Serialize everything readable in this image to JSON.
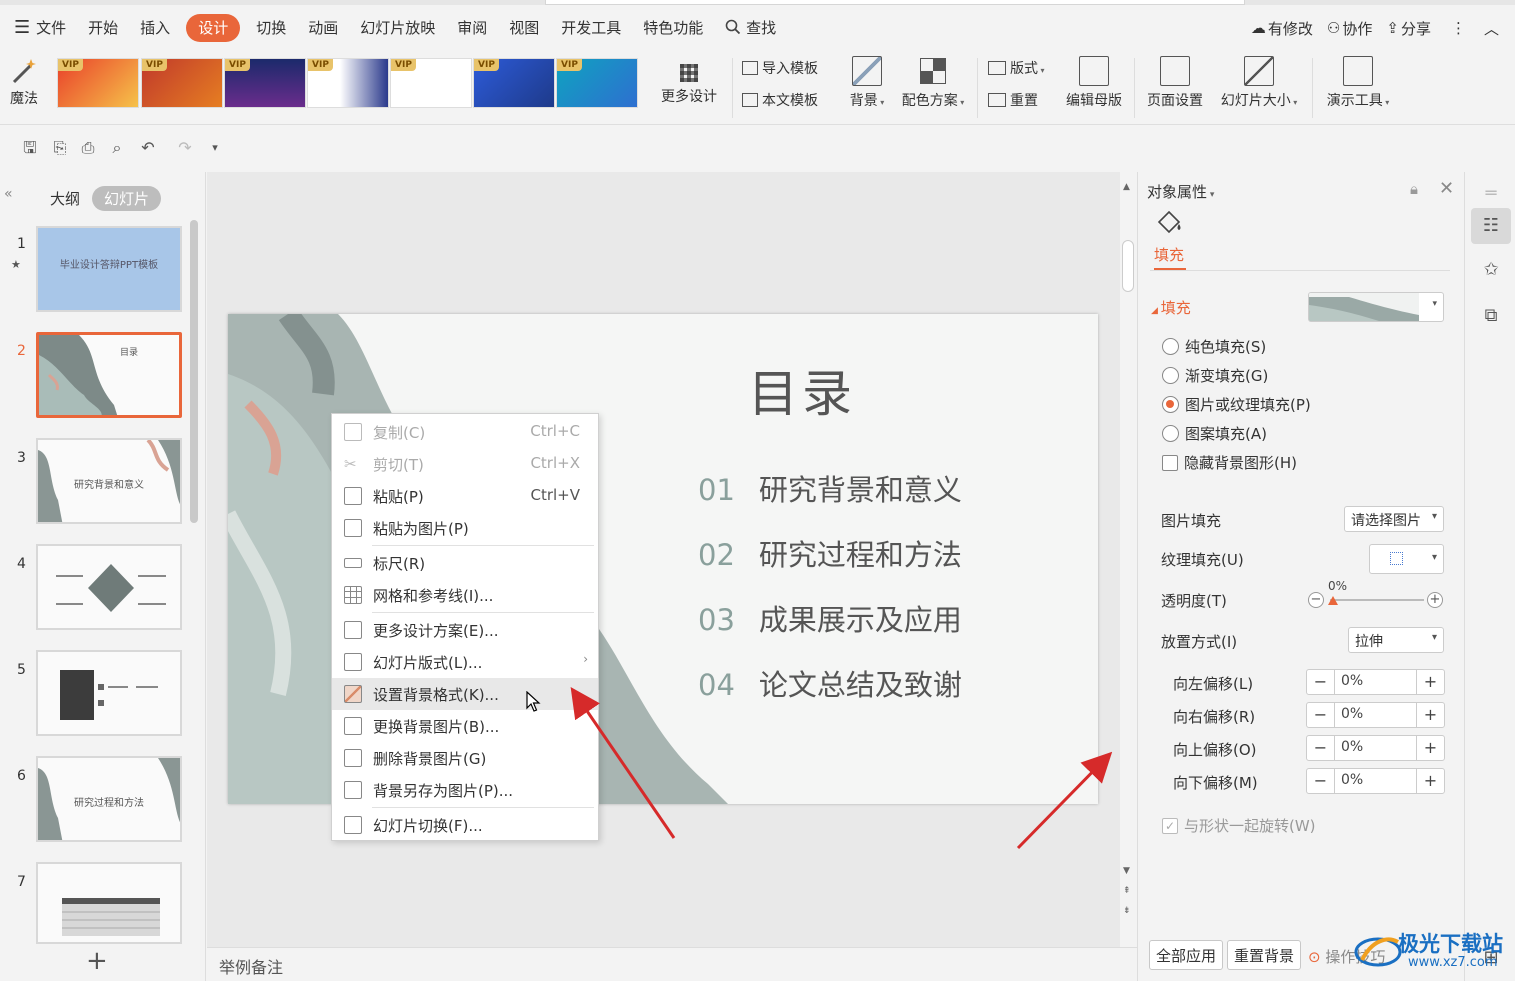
{
  "menu": {
    "items": [
      "文件",
      "开始",
      "插入",
      "设计",
      "切换",
      "动画",
      "幻灯片放映",
      "审阅",
      "视图",
      "开发工具",
      "特色功能"
    ],
    "active": "设计",
    "search_label": "查找",
    "right": {
      "modified": "有修改",
      "collab": "协作",
      "share": "分享"
    }
  },
  "ribbon": {
    "magic": "魔法",
    "vip_badge": "VIP",
    "template_titles": [
      "",
      "",
      "",
      "",
      "",
      "",
      ""
    ],
    "more_design": "更多设计",
    "import_template": "导入模板",
    "this_template": "本文模板",
    "background": "背景",
    "color_scheme": "配色方案",
    "layout": "版式",
    "reset": "重置",
    "edit_master": "编辑母版",
    "page_setup": "页面设置",
    "slide_size": "幻灯片大小",
    "presenter_tools": "演示工具"
  },
  "left_panel": {
    "tab_outline": "大纲",
    "tab_slides": "幻灯片",
    "slides": [
      {
        "num": "1",
        "text": "毕业设计答辩PPT模板"
      },
      {
        "num": "2",
        "text": "目录"
      },
      {
        "num": "3",
        "text": "研究背景和意义"
      },
      {
        "num": "4",
        "text": ""
      },
      {
        "num": "5",
        "text": ""
      },
      {
        "num": "6",
        "text": "研究过程和方法"
      },
      {
        "num": "7",
        "text": ""
      }
    ],
    "selected": "2",
    "add_symbol": "+"
  },
  "slide": {
    "title": "目录",
    "rows": [
      {
        "n": "01",
        "text": "研究背景和意义"
      },
      {
        "n": "02",
        "text": "研究过程和方法"
      },
      {
        "n": "03",
        "text": "成果展示及应用"
      },
      {
        "n": "04",
        "text": "论文总结及致谢"
      }
    ]
  },
  "notes_placeholder": "举例备注",
  "context_menu": {
    "items": [
      {
        "label": "复制(C)",
        "shortcut": "Ctrl+C",
        "disabled": true
      },
      {
        "label": "剪切(T)",
        "shortcut": "Ctrl+X",
        "disabled": true
      },
      {
        "label": "粘贴(P)",
        "shortcut": "Ctrl+V",
        "disabled": false
      },
      {
        "label": "粘贴为图片(P)",
        "shortcut": "",
        "disabled": false
      },
      {
        "label": "标尺(R)",
        "shortcut": "",
        "disabled": false
      },
      {
        "label": "网格和参考线(I)...",
        "shortcut": "",
        "disabled": false
      },
      {
        "label": "更多设计方案(E)...",
        "shortcut": "",
        "disabled": false
      },
      {
        "label": "幻灯片版式(L)...",
        "shortcut": "",
        "disabled": false
      },
      {
        "label": "设置背景格式(K)...",
        "shortcut": "",
        "disabled": false,
        "highlighted": true
      },
      {
        "label": "更换背景图片(B)...",
        "shortcut": "",
        "disabled": false
      },
      {
        "label": "删除背景图片(G)",
        "shortcut": "",
        "disabled": false
      },
      {
        "label": "背景另存为图片(P)...",
        "shortcut": "",
        "disabled": false
      },
      {
        "label": "幻灯片切换(F)...",
        "shortcut": "",
        "disabled": false
      }
    ]
  },
  "props": {
    "title": "对象属性",
    "tab": "填充",
    "section": "填充",
    "fill_options": [
      "纯色填充(S)",
      "渐变填充(G)",
      "图片或纹理填充(P)",
      "图案填充(A)"
    ],
    "fill_selected": "图片或纹理填充(P)",
    "hide_bg_shapes": "隐藏背景图形(H)",
    "picture_fill_label": "图片填充",
    "picture_fill_value": "请选择图片",
    "texture_fill_label": "纹理填充(U)",
    "transparency_label": "透明度(T)",
    "transparency_value": "0%",
    "placement_label": "放置方式(I)",
    "placement_value": "拉伸",
    "offsets": [
      {
        "label": "向左偏移(L)",
        "value": "0%"
      },
      {
        "label": "向右偏移(R)",
        "value": "0%"
      },
      {
        "label": "向上偏移(O)",
        "value": "0%"
      },
      {
        "label": "向下偏移(M)",
        "value": "0%"
      }
    ],
    "rotate_with_shape": "与形状一起旋转(W)",
    "apply_all": "全部应用",
    "reset_bg": "重置背景",
    "op_tips": "操作技巧"
  },
  "watermark": {
    "title": "极光下载站",
    "url": "www.xz7.com"
  },
  "colors": {
    "accent": "#e9663a",
    "arrow": "#d62a2a"
  }
}
